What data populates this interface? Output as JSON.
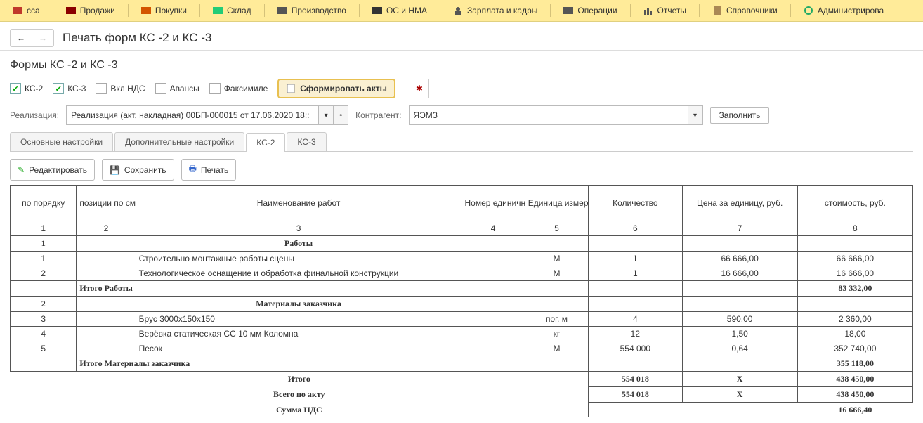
{
  "topnav": {
    "items": [
      {
        "label": "сса",
        "icon": "#c0392b"
      },
      {
        "label": "Продажи",
        "icon": "#8b0000"
      },
      {
        "label": "Покупки",
        "icon": "#d35400"
      },
      {
        "label": "Склад",
        "icon": "#2c7"
      },
      {
        "label": "Производство",
        "icon": "#555"
      },
      {
        "label": "ОС и НМА",
        "icon": "#333"
      },
      {
        "label": "Зарплата и кадры",
        "icon": "#555"
      },
      {
        "label": "Операции",
        "icon": "#555"
      },
      {
        "label": "Отчеты",
        "icon": "#555"
      },
      {
        "label": "Справочники",
        "icon": "#a85"
      },
      {
        "label": "Администрирова",
        "icon": "#2a6"
      }
    ]
  },
  "header": {
    "page_title": "Печать форм КС -2 и КС -3",
    "subtitle": "Формы КС -2 и КС -3"
  },
  "checks": {
    "ks2": "КС-2",
    "ks3": "КС-3",
    "vat": "Вкл НДС",
    "avansy": "Авансы",
    "faksimile": "Факсимиле",
    "gen_btn": "Сформировать акты"
  },
  "fields": {
    "realization_label": "Реализация:",
    "realization_value": "Реализация (акт, накладная) 00БП-000015 от 17.06.2020 18::",
    "counterparty_label": "Контрагент:",
    "counterparty_value": "ЯЭМЗ",
    "fill_btn": "Заполнить"
  },
  "tabs": {
    "t1": "Основные настройки",
    "t2": "Дополнительные настройки",
    "t3": "КС-2",
    "t4": "КС-3"
  },
  "toolbar": {
    "edit": "Редактировать",
    "save": "Сохранить",
    "print": "Печать"
  },
  "table": {
    "headers": {
      "c1": "по порядку",
      "c2": "позиции по смете",
      "c3": "Наименование работ",
      "c4": "Номер единичной расценки",
      "c5": "Единица измерения",
      "c6": "Количество",
      "c7": "Цена за единицу, руб.",
      "c8": "стоимость, руб."
    },
    "numrow": {
      "c1": "1",
      "c2": "2",
      "c3": "3",
      "c4": "4",
      "c5": "5",
      "c6": "6",
      "c7": "7",
      "c8": "8"
    },
    "s1": {
      "no": "1",
      "title": "Работы",
      "total_label": "Итого Работы",
      "total": "83 332,00"
    },
    "r1": {
      "n": "1",
      "name": "Строительно монтажные работы сцены",
      "u": "М",
      "qty": "1",
      "price": "66 666,00",
      "sum": "66 666,00"
    },
    "r2": {
      "n": "2",
      "name": "Технологическое оснащение и обработка финальной конструкции",
      "u": "М",
      "qty": "1",
      "price": "16 666,00",
      "sum": "16 666,00"
    },
    "s2": {
      "no": "2",
      "title": "Материалы заказчика",
      "total_label": "Итого Материалы заказчика",
      "total": "355 118,00"
    },
    "r3": {
      "n": "3",
      "name": "Брус 3000x150x150",
      "u": "пог. м",
      "qty": "4",
      "price": "590,00",
      "sum": "2 360,00"
    },
    "r4": {
      "n": "4",
      "name": "Верёвка статическая СС 10 мм Коломна",
      "u": "кг",
      "qty": "12",
      "price": "1,50",
      "sum": "18,00"
    },
    "r5": {
      "n": "5",
      "name": "Песок",
      "u": "М",
      "qty": "554 000",
      "price": "0,64",
      "sum": "352 740,00"
    },
    "footer": {
      "itogo_label": "Итого",
      "itogo_qty": "554 018",
      "itogo_price": "X",
      "itogo_sum": "438 450,00",
      "vsego_label": "Всего по акту",
      "vsego_qty": "554 018",
      "vsego_price": "X",
      "vsego_sum": "438 450,00",
      "nds_label": "Сумма НДС",
      "nds_sum": "16 666,40"
    }
  }
}
